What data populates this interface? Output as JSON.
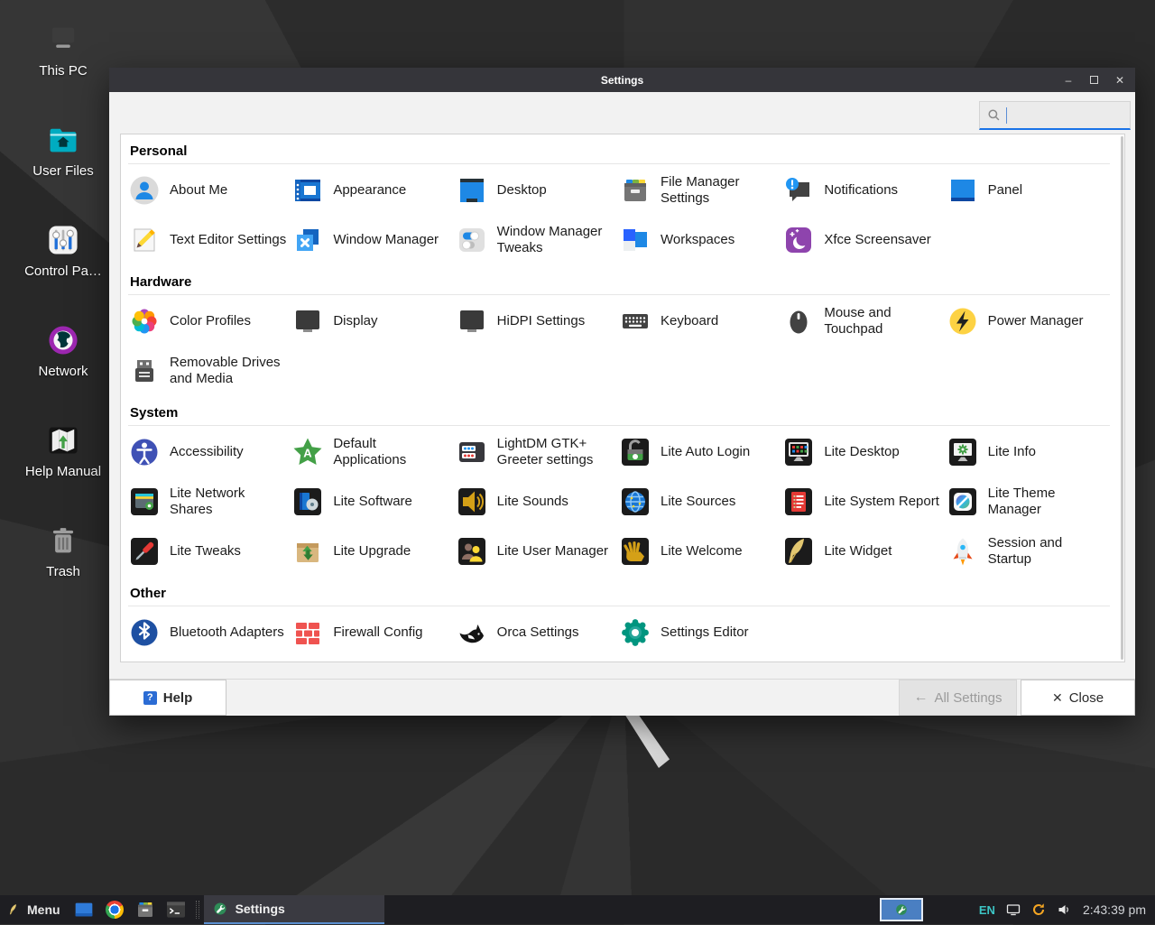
{
  "desktop": {
    "icons": [
      {
        "label": "This PC",
        "icon": "this-pc"
      },
      {
        "label": "User Files",
        "icon": "user-files"
      },
      {
        "label": "Control Pa…",
        "icon": "control-panel"
      },
      {
        "label": "Network",
        "icon": "network"
      },
      {
        "label": "Help Manual",
        "icon": "help-manual"
      },
      {
        "label": "Trash",
        "icon": "trash"
      }
    ]
  },
  "window": {
    "title": "Settings",
    "controls": {
      "minimize": "–",
      "maximize": "",
      "close": "✕"
    },
    "search": {
      "value": "",
      "placeholder": "",
      "icon": "search-icon"
    },
    "sections": [
      {
        "title": "Personal",
        "items": [
          {
            "label": "About Me",
            "icon": "about-me"
          },
          {
            "label": "Appearance",
            "icon": "appearance"
          },
          {
            "label": "Desktop",
            "icon": "desktop"
          },
          {
            "label": "File Manager Settings",
            "icon": "file-manager"
          },
          {
            "label": "Notifications",
            "icon": "notifications"
          },
          {
            "label": "Panel",
            "icon": "panel"
          },
          {
            "label": "Text Editor Settings",
            "icon": "text-editor"
          },
          {
            "label": "Window Manager",
            "icon": "window-manager"
          },
          {
            "label": "Window Manager Tweaks",
            "icon": "wm-tweaks"
          },
          {
            "label": "Workspaces",
            "icon": "workspaces"
          },
          {
            "label": "Xfce Screensaver",
            "icon": "screensaver"
          }
        ]
      },
      {
        "title": "Hardware",
        "items": [
          {
            "label": "Color Profiles",
            "icon": "color-profiles"
          },
          {
            "label": "Display",
            "icon": "display"
          },
          {
            "label": "HiDPI Settings",
            "icon": "hidpi"
          },
          {
            "label": "Keyboard",
            "icon": "keyboard"
          },
          {
            "label": "Mouse and Touchpad",
            "icon": "mouse"
          },
          {
            "label": "Power Manager",
            "icon": "power"
          },
          {
            "label": "Removable Drives and Media",
            "icon": "removable"
          }
        ]
      },
      {
        "title": "System",
        "items": [
          {
            "label": "Accessibility",
            "icon": "accessibility"
          },
          {
            "label": "Default Applications",
            "icon": "default-apps"
          },
          {
            "label": "LightDM GTK+ Greeter settings",
            "icon": "lightdm"
          },
          {
            "label": "Lite Auto Login",
            "icon": "auto-login"
          },
          {
            "label": "Lite Desktop",
            "icon": "lite-desktop"
          },
          {
            "label": "Lite Info",
            "icon": "lite-info"
          },
          {
            "label": "Lite Network Shares",
            "icon": "network-shares"
          },
          {
            "label": "Lite Software",
            "icon": "software"
          },
          {
            "label": "Lite Sounds",
            "icon": "sounds"
          },
          {
            "label": "Lite Sources",
            "icon": "sources"
          },
          {
            "label": "Lite System Report",
            "icon": "system-report"
          },
          {
            "label": "Lite Theme Manager",
            "icon": "theme-manager"
          },
          {
            "label": "Lite Tweaks",
            "icon": "tweaks"
          },
          {
            "label": "Lite Upgrade",
            "icon": "upgrade"
          },
          {
            "label": "Lite User Manager",
            "icon": "user-manager"
          },
          {
            "label": "Lite Welcome",
            "icon": "welcome"
          },
          {
            "label": "Lite Widget",
            "icon": "widget"
          },
          {
            "label": "Session and Startup",
            "icon": "session"
          }
        ]
      },
      {
        "title": "Other",
        "items": [
          {
            "label": "Bluetooth Adapters",
            "icon": "bluetooth"
          },
          {
            "label": "Firewall Config",
            "icon": "firewall"
          },
          {
            "label": "Orca Settings",
            "icon": "orca"
          },
          {
            "label": "Settings Editor",
            "icon": "settings-editor"
          }
        ]
      }
    ],
    "footer": {
      "help": "Help",
      "all_settings": "All Settings",
      "close": "Close"
    }
  },
  "taskbar": {
    "menu_label": "Menu",
    "launchers": [
      "show-desktop",
      "chrome",
      "file-manager-launcher",
      "terminal"
    ],
    "task": {
      "label": "Settings",
      "icon": "lite-settings"
    },
    "tray": {
      "language": "EN",
      "time": "2:43:39 pm"
    }
  },
  "colors": {
    "accent_blue": "#1a73e8",
    "titlebar": "#35353a",
    "taskbar": "#1e1e22",
    "panel_bg": "#ffffff"
  }
}
